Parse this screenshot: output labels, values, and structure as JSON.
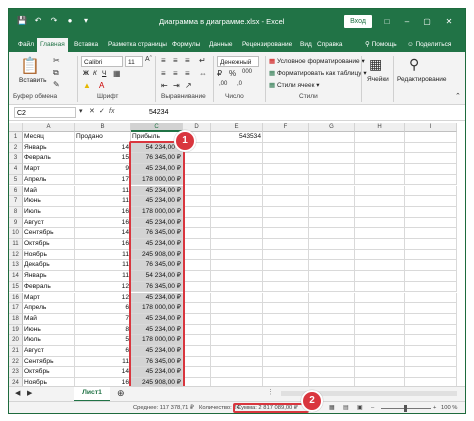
{
  "title_bar": {
    "title": "Диаграмма в диаграмме.xlsx - Excel",
    "login_label": "Вход",
    "quick_access_icons": [
      "save-icon",
      "undo-icon",
      "redo-icon",
      "camera-icon",
      "more-icon"
    ]
  },
  "tabs": [
    "Файл",
    "Главная",
    "Вставка",
    "Разметка страницы",
    "Формулы",
    "Данные",
    "Рецензирование",
    "Вид",
    "Справка"
  ],
  "tabs_right": {
    "help": "Помощь",
    "share": "Поделиться"
  },
  "ribbon": {
    "clipboard": {
      "paste_label": "Вставить",
      "group_label": "Буфер обмена"
    },
    "font": {
      "font_name": "Calibri",
      "font_size": "11",
      "bold": "Ж",
      "italic": "К",
      "underline": "Ч",
      "group_label": "Шрифт"
    },
    "alignment": {
      "group_label": "Выравнивание"
    },
    "number": {
      "format": "Денежный",
      "group_label": "Число"
    },
    "styles": {
      "conditional": "Условное форматирование",
      "as_table": "Форматировать как таблицу",
      "cell_styles": "Стили ячеек",
      "group_label": "Стили"
    },
    "cells": {
      "label": "Ячейки"
    },
    "editing": {
      "label": "Редактирование"
    }
  },
  "formula_bar": {
    "name_box": "C2",
    "fx": "fx",
    "value": "54234"
  },
  "columns": [
    "A",
    "B",
    "C",
    "D",
    "E",
    "F",
    "G",
    "H",
    "I"
  ],
  "header_row": {
    "a": "Месяц",
    "b": "Продано",
    "c": "Прибыль",
    "e": "543534"
  },
  "rows": [
    {
      "month": "Январь",
      "sold": "14",
      "profit": "54 234,00 ₽"
    },
    {
      "month": "Февраль",
      "sold": "15",
      "profit": "76 345,00 ₽"
    },
    {
      "month": "Март",
      "sold": "9",
      "profit": "45 234,00 ₽"
    },
    {
      "month": "Апрель",
      "sold": "17",
      "profit": "178 000,00 ₽"
    },
    {
      "month": "Май",
      "sold": "11",
      "profit": "45 234,00 ₽"
    },
    {
      "month": "Июнь",
      "sold": "11",
      "profit": "45 234,00 ₽"
    },
    {
      "month": "Июль",
      "sold": "16",
      "profit": "178 000,00 ₽"
    },
    {
      "month": "Август",
      "sold": "16",
      "profit": "45 234,00 ₽"
    },
    {
      "month": "Сентябрь",
      "sold": "14",
      "profit": "76 345,00 ₽"
    },
    {
      "month": "Октябрь",
      "sold": "16",
      "profit": "45 234,00 ₽"
    },
    {
      "month": "Ноябрь",
      "sold": "11",
      "profit": "245 908,00 ₽"
    },
    {
      "month": "Декабрь",
      "sold": "11",
      "profit": "76 345,00 ₽"
    },
    {
      "month": "Январь",
      "sold": "11",
      "profit": "54 234,00 ₽"
    },
    {
      "month": "Февраль",
      "sold": "12",
      "profit": "76 345,00 ₽"
    },
    {
      "month": "Март",
      "sold": "12",
      "profit": "45 234,00 ₽"
    },
    {
      "month": "Апрель",
      "sold": "6",
      "profit": "178 000,00 ₽"
    },
    {
      "month": "Май",
      "sold": "7",
      "profit": "45 234,00 ₽"
    },
    {
      "month": "Июнь",
      "sold": "8",
      "profit": "45 234,00 ₽"
    },
    {
      "month": "Июль",
      "sold": "5",
      "profit": "178 000,00 ₽"
    },
    {
      "month": "Август",
      "sold": "6",
      "profit": "45 234,00 ₽"
    },
    {
      "month": "Сентябрь",
      "sold": "11",
      "profit": "76 345,00 ₽"
    },
    {
      "month": "Октябрь",
      "sold": "14",
      "profit": "45 234,00 ₽"
    },
    {
      "month": "Ноябрь",
      "sold": "16",
      "profit": "245 908,00 ₽"
    },
    {
      "month": "Декабрь",
      "sold": "12",
      "profit": "76 345,00 ₽"
    }
  ],
  "badges": {
    "one": "1",
    "two": "2"
  },
  "sheet_tab": "Лист1",
  "status_bar": {
    "average": "Среднее: 117 378,71 ₽",
    "count": "Количество: 24",
    "sum": "Сумма: 2 817 089,00 ₽",
    "zoom": "100 %"
  },
  "colors": {
    "accent": "#217346",
    "highlight": "#d9363e",
    "selection": "#d3d3d3"
  }
}
